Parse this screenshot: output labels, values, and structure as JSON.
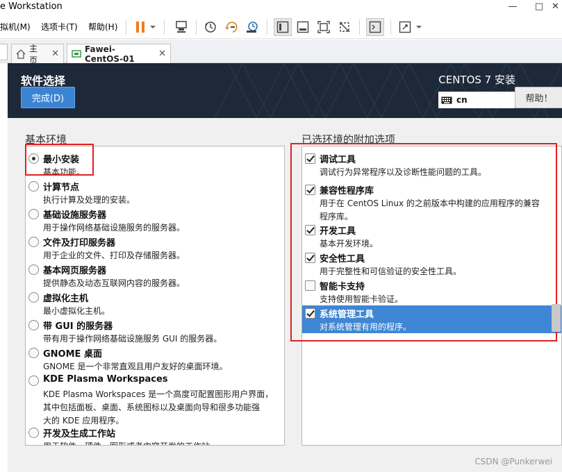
{
  "window": {
    "title": "e Workstation",
    "controls": [
      "—",
      "□",
      "✕"
    ]
  },
  "menu": {
    "items": [
      "拟机(M)",
      "选项卡(T)",
      "帮助(H)"
    ]
  },
  "tabs": [
    {
      "label": "主页"
    },
    {
      "label": "Fawei-CentOS-01"
    }
  ],
  "header": {
    "page_title": "软件选择",
    "done_button": "完成(D)",
    "product": "CENTOS 7 安装",
    "keyboard_layout": "cn",
    "help_button": "帮助！"
  },
  "base_env": {
    "title": "基本环境",
    "items": [
      {
        "name": "最小安装",
        "desc": [
          "基本功能。"
        ],
        "selected": true
      },
      {
        "name": "计算节点",
        "desc": [
          "执行计算及处理的安装。"
        ],
        "selected": false
      },
      {
        "name": "基础设施服务器",
        "desc": [
          "用于操作网络基础设施服务的服务器。"
        ],
        "selected": false
      },
      {
        "name": "文件及打印服务器",
        "desc": [
          "用于企业的文件、打印及存储服务器。"
        ],
        "selected": false
      },
      {
        "name": "基本网页服务器",
        "desc": [
          "提供静态及动态互联网内容的服务器。"
        ],
        "selected": false
      },
      {
        "name": "虚拟化主机",
        "desc": [
          "最小虚拟化主机。"
        ],
        "selected": false
      },
      {
        "name": "带 GUI 的服务器",
        "desc": [
          "带有用于操作网络基础设施服务 GUI 的服务器。"
        ],
        "selected": false
      },
      {
        "name": "GNOME 桌面",
        "desc": [
          "GNOME 是一个非常直观且用户友好的桌面环境。"
        ],
        "selected": false
      },
      {
        "name": "KDE Plasma Workspaces",
        "desc": [
          "KDE Plasma Workspaces 是一个高度可配置图形用户界面，",
          "其中包括面板、桌面、系统图标以及桌面向导和很多功能强",
          "大的 KDE 应用程序。"
        ],
        "selected": false
      },
      {
        "name": "开发及生成工作站",
        "desc": [
          "用于软件、硬件、图形或者内容开发的工作站。"
        ],
        "selected": false
      }
    ]
  },
  "addons": {
    "title": "已选环境的附加选项",
    "items": [
      {
        "name": "调试工具",
        "desc": [
          "调试行为异常程序以及诊断性能问题的工具。"
        ],
        "checked": true,
        "highlighted": false
      },
      {
        "name": "兼容性程序库",
        "desc": [
          "用于在 CentOS Linux 的之前版本中构建的应用程序的兼容",
          "程序库。"
        ],
        "checked": true,
        "highlighted": false
      },
      {
        "name": "开发工具",
        "desc": [
          "基本开发环境。"
        ],
        "checked": true,
        "highlighted": false
      },
      {
        "name": "安全性工具",
        "desc": [
          "用于完整性和可信验证的安全性工具。"
        ],
        "checked": true,
        "highlighted": false
      },
      {
        "name": "智能卡支持",
        "desc": [
          "支持使用智能卡验证。"
        ],
        "checked": false,
        "highlighted": false
      },
      {
        "name": "系统管理工具",
        "desc": [
          "对系统管理有用的程序。"
        ],
        "checked": true,
        "highlighted": true
      }
    ]
  },
  "watermark": "CSDN @Punkerwei",
  "colors": {
    "header_bg": "#1d2939",
    "accent_blue": "#3f86d4",
    "annotation_red": "#e02020"
  }
}
